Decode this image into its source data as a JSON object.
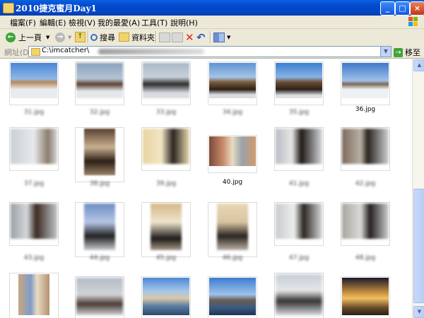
{
  "window": {
    "title": "2010捷克蜜月Day1",
    "minimize": "_",
    "maximize": "□",
    "close": "×"
  },
  "menu": [
    "檔案(F)",
    "編輯(E)",
    "檢視(V)",
    "我的最愛(A)",
    "工具(T)",
    "說明(H)"
  ],
  "toolbar": {
    "back": "上一頁",
    "search": "搜尋",
    "folders": "資料夾"
  },
  "address": {
    "label": "網址(D)",
    "path": "C:\\imcatcher\\",
    "go": "移至"
  },
  "files": [
    {
      "name": "31.jpg",
      "blurred": true
    },
    {
      "name": "32.jpg",
      "blurred": true
    },
    {
      "name": "33.jpg",
      "blurred": true
    },
    {
      "name": "34.jpg",
      "blurred": true
    },
    {
      "name": "35.jpg",
      "blurred": true
    },
    {
      "name": "36.jpg",
      "blurred": false
    },
    {
      "name": "37.jpg",
      "blurred": true
    },
    {
      "name": "38.jpg",
      "blurred": true
    },
    {
      "name": "39.jpg",
      "blurred": true
    },
    {
      "name": "40.jpg",
      "blurred": false
    },
    {
      "name": "41.jpg",
      "blurred": true
    },
    {
      "name": "42.jpg",
      "blurred": true
    },
    {
      "name": "43.jpg",
      "blurred": true
    },
    {
      "name": "44.jpg",
      "blurred": true
    },
    {
      "name": "45.jpg",
      "blurred": true
    },
    {
      "name": "46.jpg",
      "blurred": true
    },
    {
      "name": "47.jpg",
      "blurred": true
    },
    {
      "name": "48.jpg",
      "blurred": true
    }
  ],
  "colors": {
    "titlebar": "#0447c9",
    "chrome": "#ece9d8",
    "accent": "#1556e3"
  }
}
